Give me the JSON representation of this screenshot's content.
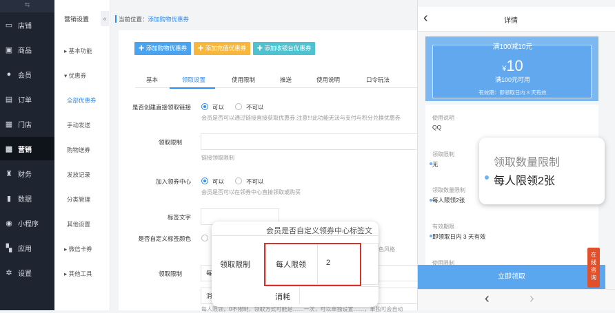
{
  "nav": {
    "items": [
      {
        "label": "店铺",
        "icon": "store-icon",
        "glyph": "▭"
      },
      {
        "label": "商品",
        "icon": "goods-icon",
        "glyph": "▣"
      },
      {
        "label": "会员",
        "icon": "member-icon",
        "glyph": "●"
      },
      {
        "label": "订单",
        "icon": "order-icon",
        "glyph": "▤"
      },
      {
        "label": "门店",
        "icon": "shop-icon",
        "glyph": "▦"
      },
      {
        "label": "营销",
        "icon": "gift-icon",
        "glyph": "▩"
      },
      {
        "label": "财务",
        "icon": "finance-icon",
        "glyph": "♜"
      },
      {
        "label": "数据",
        "icon": "data-icon",
        "glyph": "▮"
      },
      {
        "label": "小程序",
        "icon": "miniapp-icon",
        "glyph": "◉"
      },
      {
        "label": "应用",
        "icon": "apps-icon",
        "glyph": "▚"
      },
      {
        "label": "设置",
        "icon": "settings-icon",
        "glyph": "✲"
      }
    ],
    "active": "营销"
  },
  "subnav": {
    "title": "营销设置",
    "collapse": "«",
    "items": [
      "▸ 基本功能",
      "▾ 优惠券",
      "全部优惠券",
      "手动发送",
      "购物送券",
      "发放记录",
      "分类管理",
      "其他设置",
      "▸ 微信卡券",
      "▸ 其他工具"
    ]
  },
  "breadcrumb": {
    "prefix": "当前位置：",
    "current": "添加购物优惠券"
  },
  "buttons": {
    "add_shopping": "✚ 添加购物优惠券",
    "add_recharge": "✚ 添加充值优惠券",
    "add_cashier": "✚ 添加收银台优惠券"
  },
  "colors": {
    "accent": "#2d8cf0",
    "recharge": "#f6b73c",
    "cashier": "#4fc2cf",
    "shopping": "#4aa3ee"
  },
  "tabs": [
    "基本",
    "领取设置",
    "使用限制",
    "推送",
    "使用说明",
    "口令玩法"
  ],
  "active_tab": "领取设置",
  "form": {
    "direct_link_label": "是否创建直接领取链接",
    "yes": "可以",
    "no": "不可以",
    "direct_link_help": "会员是否可以通过链接直接获取优惠券,注意!!!此功能无法与支付与积分兑换优惠券",
    "limit_label": "领取限制",
    "limit_help": "链接领取限制",
    "center_label": "加入领券中心",
    "center_help": "会员是否可以在领券中心直接领取或购买",
    "tag_text_label": "标签文字",
    "tag_color_label": "是否自定义标签颜色",
    "tag_color_help": "色风格",
    "claim_limit_label": "领取限制",
    "claim_limit_prefix": "每",
    "consume_prefix": "消",
    "bottom_help": "每人限领，0不限制，领取方式可能是……一次，可以单独设置……，单独可会自动"
  },
  "zoom_form": {
    "header": "会员是否自定义领券中心标签文",
    "label": "领取限制",
    "per_person": "每人限领",
    "value": "2",
    "consume": "消耗"
  },
  "phone": {
    "title": "详情",
    "back": "‹",
    "coupon_title": "满100减10元",
    "currency": "¥",
    "amount": "10",
    "usage": "满100元可用",
    "validity": "有效期：即领取日内 3 天有效",
    "items": [
      {
        "title": "使用说明",
        "value": "QQ"
      },
      {
        "title": "领取限制",
        "value": "无"
      },
      {
        "title": "领取数量限制",
        "value": "每人限领2张"
      },
      {
        "title": "有效期限",
        "value": "即领取日内 3 天有效"
      },
      {
        "title": "使用限制",
        "value": ""
      }
    ],
    "claim_button": "立即领取",
    "prev": "‹",
    "next": "›",
    "consult": [
      "在",
      "线",
      "咨",
      "询"
    ]
  },
  "zoom_detail": {
    "title": "领取数量限制",
    "value": "每人限领2张"
  }
}
